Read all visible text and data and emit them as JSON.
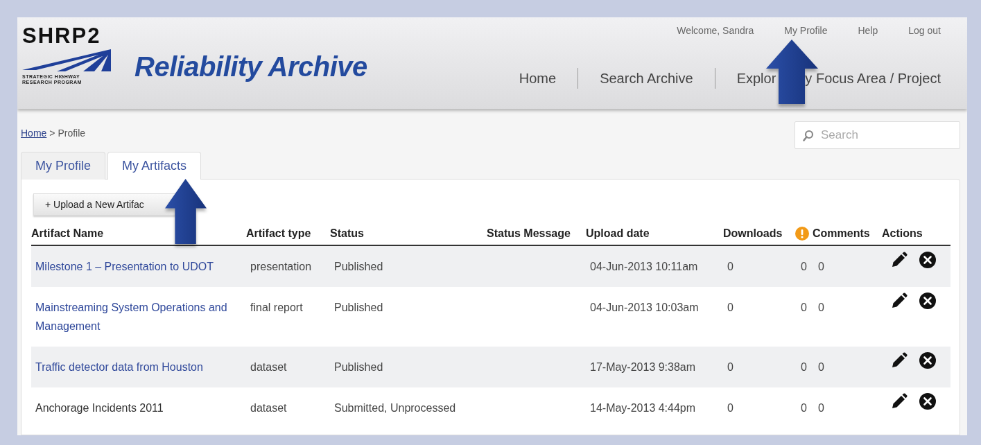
{
  "logo": {
    "wordmark": "SHRP2",
    "tagline": [
      "STRATEGIC HIGHWAY",
      "RESEARCH PROGRAM"
    ]
  },
  "site_title": "Reliability Archive",
  "user_links": [
    {
      "label": "Welcome, Sandra"
    },
    {
      "label": "My Profile"
    },
    {
      "label": "Help"
    },
    {
      "label": "Log out"
    }
  ],
  "nav": [
    {
      "label": "Home"
    },
    {
      "label": "Search Archive"
    },
    {
      "label": "Explor",
      "label_after_arrow": "y Focus Area / Project"
    }
  ],
  "breadcrumb": {
    "link": "Home",
    "current": "> Profile"
  },
  "search": {
    "placeholder": "Search"
  },
  "tabs": [
    {
      "label": "My Profile",
      "selected": false
    },
    {
      "label": "My Artifacts",
      "selected": true
    }
  ],
  "upload_button": "+ Upload a New Artifac",
  "table": {
    "columns": [
      {
        "label": "Artifact Name"
      },
      {
        "label": "Artifact type"
      },
      {
        "label": "Status"
      },
      {
        "label": "Status Message"
      },
      {
        "label": "Upload date"
      },
      {
        "label": "Downloads"
      },
      {
        "label": "Comments",
        "alert": true
      },
      {
        "label": "Actions"
      }
    ],
    "rows": [
      {
        "name": "Milestone 1 – Presentation to UDOT",
        "link": true,
        "type": "presentation",
        "status": "Published",
        "upload_date": "04-Jun-2013 10:11am",
        "downloads": "0",
        "comments": [
          "0",
          "0"
        ]
      },
      {
        "name": "Mainstreaming System Operations and Management",
        "link": true,
        "type": "final report",
        "status": "Published",
        "upload_date": "04-Jun-2013 10:03am",
        "downloads": "0",
        "comments": [
          "0",
          "0"
        ]
      },
      {
        "name": "Traffic detector data from Houston",
        "link": true,
        "type": "dataset",
        "status": "Published",
        "upload_date": "17-May-2013 9:38am",
        "downloads": "0",
        "comments": [
          "0",
          "0"
        ]
      },
      {
        "name": "Anchorage Incidents 2011",
        "link": false,
        "type": "dataset",
        "status": "Submitted, Unprocessed",
        "upload_date": "14-May-2013 4:44pm",
        "downloads": "0",
        "comments": [
          "0",
          "0"
        ]
      }
    ]
  }
}
